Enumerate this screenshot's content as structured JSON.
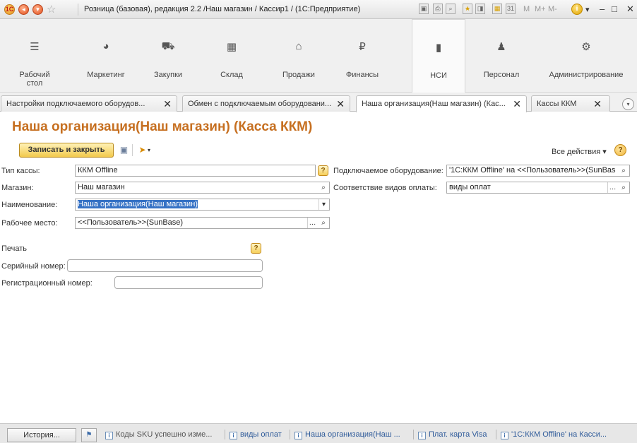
{
  "window": {
    "title": "Розница (базовая), редакция 2.2 /Наш магазин / Кассир1 / (1С:Предприятие)",
    "mm_labels": [
      "M",
      "M+",
      "M-"
    ]
  },
  "main_menu": [
    {
      "label": "Рабочий стол",
      "icon": "desktop-icon"
    },
    {
      "label": "Маркетинг",
      "icon": "marketing-icon"
    },
    {
      "label": "Закупки",
      "icon": "purchases-icon"
    },
    {
      "label": "Склад",
      "icon": "warehouse-icon"
    },
    {
      "label": "Продажи",
      "icon": "sales-icon"
    },
    {
      "label": "Финансы",
      "icon": "finance-icon"
    },
    {
      "label": "НСИ",
      "icon": "reference-data-icon",
      "active": true
    },
    {
      "label": "Персонал",
      "icon": "personnel-icon"
    },
    {
      "label": "Администрирование",
      "icon": "administration-icon"
    }
  ],
  "tabs": [
    {
      "label": "Настройки подключаемого оборудов..."
    },
    {
      "label": "Обмен с подключаемым оборудовани..."
    },
    {
      "label": "Наша организация(Наш магазин) (Кас...",
      "active": true
    },
    {
      "label": "Кассы ККМ"
    }
  ],
  "form": {
    "title": "Наша организация(Наш магазин) (Касса ККМ)",
    "save_close_label": "Записать и закрыть",
    "all_actions_label": "Все действия ▾",
    "help_label": "?",
    "fields": {
      "cash_type": {
        "label": "Тип кассы:",
        "value": "ККМ Offline"
      },
      "store": {
        "label": "Магазин:",
        "value": "Наш магазин"
      },
      "name": {
        "label": "Наименование:",
        "value": "Наша организация(Наш магазин)"
      },
      "workplace": {
        "label": "Рабочее место:",
        "value": "<<Пользователь>>(SunBase)"
      },
      "equipment": {
        "label": "Подключаемое оборудование:",
        "value": "'1C:ККМ Offline' на <<Пользователь>>(SunBase"
      },
      "payment_types": {
        "label": "Соответствие видов оплаты:",
        "value": "виды оплат"
      },
      "serial": {
        "label": "Серийный номер:",
        "value": ""
      },
      "registration": {
        "label": "Регистрационный номер:",
        "value": ""
      }
    },
    "print_label": "Печать"
  },
  "statusbar": {
    "history_label": "История...",
    "items": [
      {
        "label": "Коды SKU успешно изме..."
      },
      {
        "label": "виды оплат"
      },
      {
        "label": "Наша организация(Наш ..."
      },
      {
        "label": "Плат. карта Visa"
      },
      {
        "label": "'1C:ККМ Offline' на Касси..."
      }
    ]
  }
}
